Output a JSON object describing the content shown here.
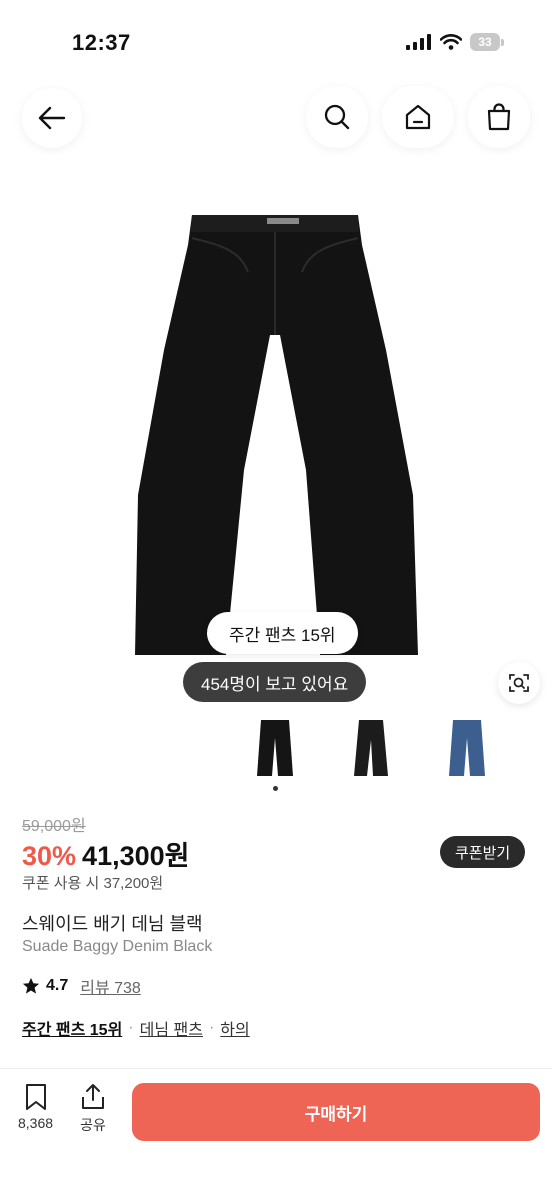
{
  "status_bar": {
    "time": "12:37",
    "battery": "33"
  },
  "product": {
    "rank_badge": "주간 팬츠 15위",
    "viewers": "454명이 보고 있어요",
    "thumbnails": [
      {
        "name": "thumb-black-front",
        "color": "#151515"
      },
      {
        "name": "thumb-black-side",
        "color": "#1a1a1a"
      },
      {
        "name": "thumb-denim-blue",
        "color": "#3c5f8f"
      }
    ],
    "original_price": "59,000원",
    "discount": "30%",
    "price": "41,300원",
    "coupon_button": "쿠폰받기",
    "coupon_price": "쿠폰 사용 시 37,200원",
    "title_ko": "스웨이드 배기 데님 블랙",
    "title_en": "Suade Baggy Denim Black",
    "rating": "4.7",
    "review_label": "리뷰 738",
    "tags": [
      "주간 팬츠 15위",
      "데님 팬츠",
      "하의"
    ],
    "tag_separator": "·"
  },
  "bottom_bar": {
    "save_count": "8,368",
    "share_label": "공유",
    "buy_label": "구매하기"
  },
  "colors": {
    "accent": "#ee6555",
    "discount": "#ee5a4a",
    "dark_pill": "#3d3d3d"
  }
}
